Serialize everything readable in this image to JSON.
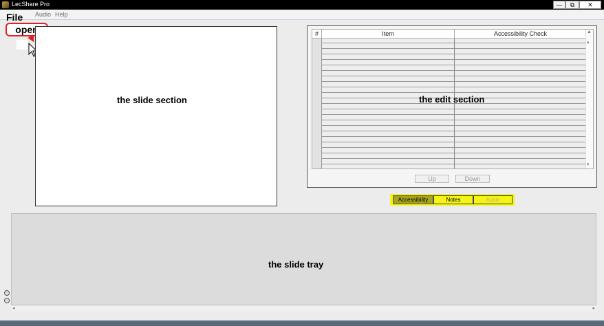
{
  "window": {
    "title": "LecShare Pro",
    "controls": {
      "minimize": "—",
      "maximize": "⧉",
      "close": "✕"
    }
  },
  "menu": {
    "items": [
      "File",
      "Audio",
      "Help"
    ]
  },
  "annotations": {
    "open_callout": "open",
    "slide_section": "the slide section",
    "edit_section": "the edit section",
    "slide_tray": "the slide tray"
  },
  "grid": {
    "columns": [
      "#",
      "Item",
      "Accessibility Check"
    ],
    "row_count": 23
  },
  "buttons": {
    "up": "Up",
    "down": "Down"
  },
  "tabs": [
    {
      "label": "Accessibility",
      "state": "active"
    },
    {
      "label": "Notes",
      "state": "normal"
    },
    {
      "label": "Audio",
      "state": "disabled"
    }
  ],
  "colors": {
    "highlight": "#f4f416",
    "active_tab": "#a6a61c",
    "callout_border": "#d22222"
  }
}
